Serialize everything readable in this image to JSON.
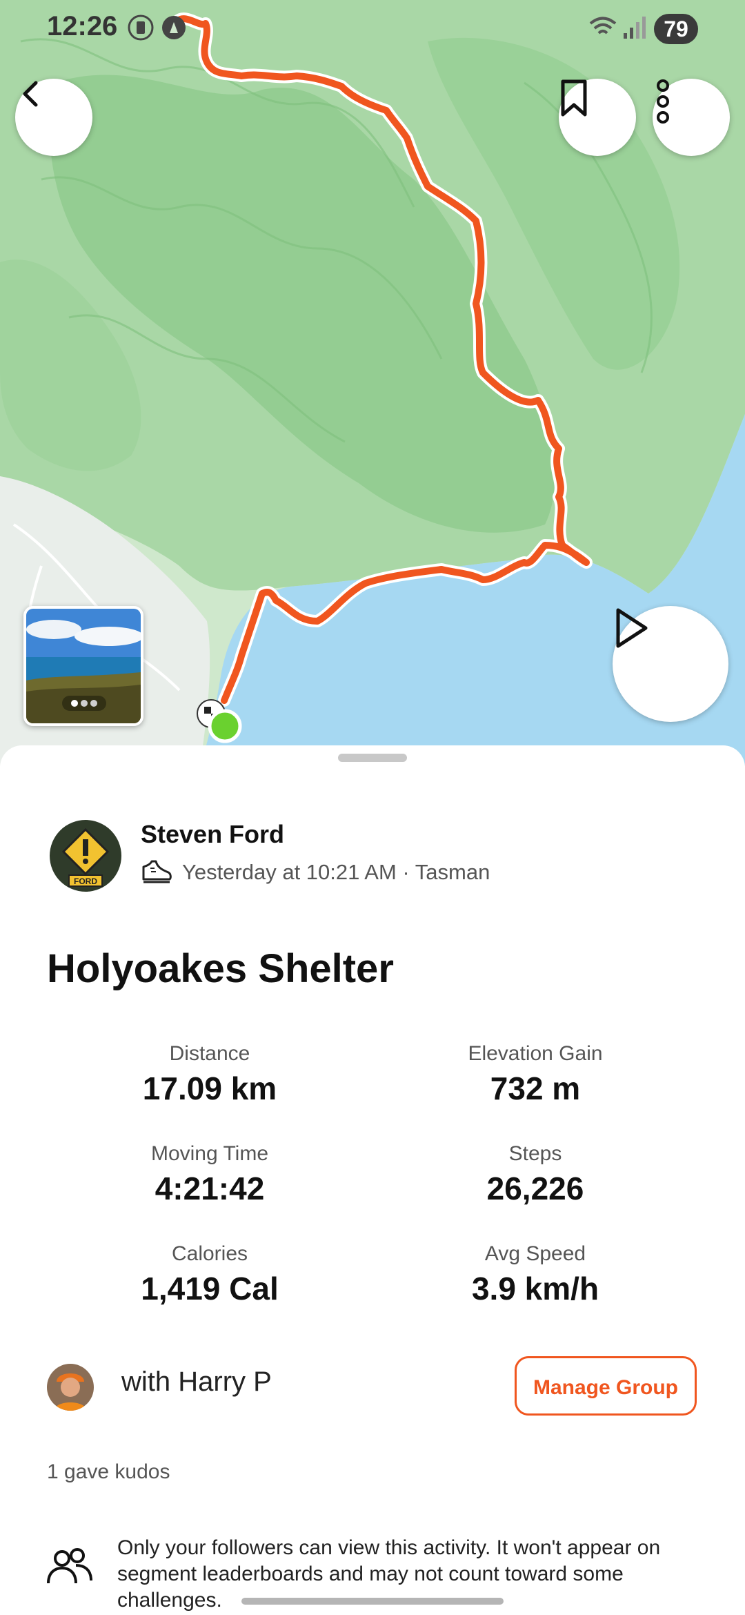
{
  "status_bar": {
    "time": "12:26",
    "battery": "79"
  },
  "map": {
    "colors": {
      "land": "#cfe8cc",
      "forest": "#8fcb8d",
      "water": "#a6d8f2",
      "route": "#f0561f",
      "start_marker": "#6ad12f"
    }
  },
  "athlete": {
    "name": "Steven Ford",
    "meta": "Yesterday at 10:21 AM · Tasman",
    "avatar_badge": "FORD"
  },
  "activity": {
    "title": "Holyoakes Shelter",
    "stats": [
      {
        "label": "Distance",
        "value": "17.09 km"
      },
      {
        "label": "Elevation Gain",
        "value": "732 m"
      },
      {
        "label": "Moving Time",
        "value": "4:21:42"
      },
      {
        "label": "Steps",
        "value": "26,226"
      },
      {
        "label": "Calories",
        "value": "1,419 Cal"
      },
      {
        "label": "Avg Speed",
        "value": "3.9 km/h"
      }
    ]
  },
  "group": {
    "with_text": "with Harry P",
    "manage_label": "Manage Group"
  },
  "kudos": "1 gave kudos",
  "privacy_text": "Only your followers can view this activity. It won't appear on segment leaderboards and may not count toward some challenges.",
  "accent_color": "#f0561f"
}
